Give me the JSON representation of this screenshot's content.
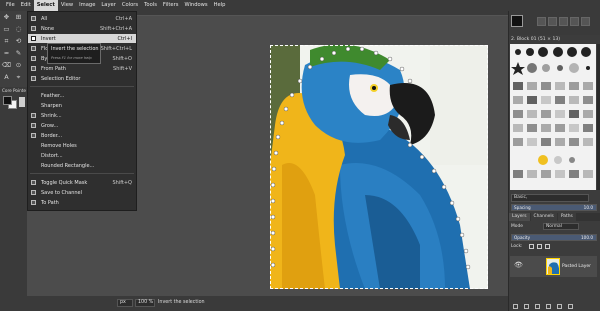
{
  "menubar": [
    "File",
    "Edit",
    "Select",
    "View",
    "Image",
    "Layer",
    "Colors",
    "Tools",
    "Filters",
    "Windows",
    "Help"
  ],
  "select_menu": {
    "items": [
      {
        "label": "All",
        "shortcut": "Ctrl+A",
        "icon": "select-all-icon"
      },
      {
        "label": "None",
        "shortcut": "Shift+Ctrl+A",
        "icon": "select-none-icon"
      },
      {
        "label": "Invert",
        "shortcut": "Ctrl+I",
        "icon": "invert-icon",
        "highlighted": true
      },
      {
        "label": "Float",
        "shortcut": "Shift+Ctrl+L",
        "icon": "float-icon"
      },
      {
        "label": "By Color",
        "shortcut": "Shift+O",
        "icon": "by-color-icon"
      },
      {
        "label": "From Path",
        "shortcut": "Shift+V",
        "icon": "from-path-icon"
      },
      {
        "label": "Selection Editor",
        "shortcut": "",
        "icon": "selection-editor-icon"
      },
      {
        "label": "Feather...",
        "shortcut": "",
        "icon": "feather-icon"
      },
      {
        "label": "Sharpen",
        "shortcut": "",
        "icon": "sharpen-icon"
      },
      {
        "label": "Shrink...",
        "shortcut": "",
        "icon": "shrink-icon"
      },
      {
        "label": "Grow...",
        "shortcut": "",
        "icon": "grow-icon"
      },
      {
        "label": "Border...",
        "shortcut": "",
        "icon": "border-icon"
      },
      {
        "label": "Remove Holes",
        "shortcut": "",
        "icon": "remove-holes-icon"
      },
      {
        "label": "Distort...",
        "shortcut": "",
        "icon": "distort-icon"
      },
      {
        "label": "Rounded Rectangle...",
        "shortcut": "",
        "icon": "rounded-rectangle-icon"
      },
      {
        "label": "Toggle Quick Mask",
        "shortcut": "Shift+Q",
        "icon": "quick-mask-icon"
      },
      {
        "label": "Save to Channel",
        "shortcut": "",
        "icon": "save-channel-icon"
      },
      {
        "label": "To Path",
        "shortcut": "",
        "icon": "to-path-icon"
      }
    ]
  },
  "tooltip": {
    "title": "Invert the selection",
    "hint": "Press F1 for more help"
  },
  "tool_options": {
    "tab_label": "Core Pointe"
  },
  "status": {
    "unit": "px",
    "zoom": "100 %",
    "message": "Invert the selection"
  },
  "dock": {
    "brush_name": "2. Block 01 (51 × 13)",
    "preset": "Basic,",
    "spacing_label": "Spacing",
    "spacing_value": "10.0",
    "tabs": [
      "Layers",
      "Channels",
      "Paths"
    ],
    "mode_label": "Mode",
    "mode_value": "Normal",
    "opacity_label": "Opacity",
    "opacity_value": "100.0",
    "lock_label": "Lock:",
    "layer_name": "Pasted Layer"
  },
  "colors": {
    "menu_bg": "#2f2f2f",
    "highlight": "#d6d6d6",
    "panel": "#3c3c3c",
    "canvas_bg": "#4c4c4c",
    "macaw_blue": "#1f6fb0",
    "macaw_yellow": "#f0b51a"
  }
}
